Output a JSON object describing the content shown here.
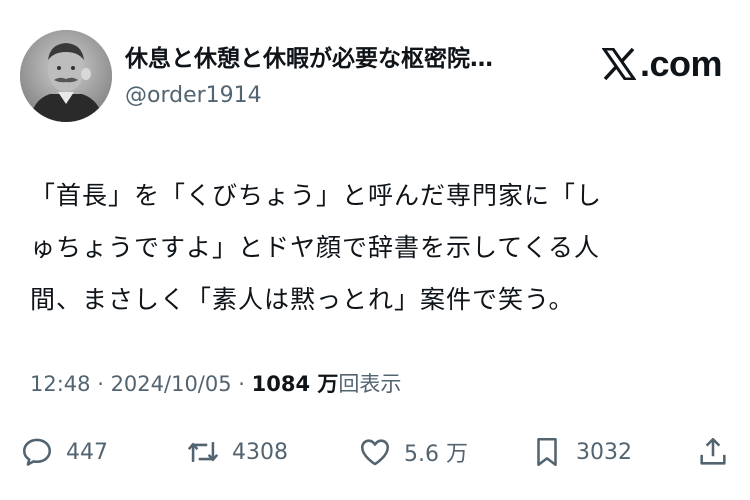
{
  "author": {
    "display_name": "休息と休憩と休暇が必要な枢密院…",
    "handle": "@order1914"
  },
  "brand": {
    "text": "com",
    "icon": "x-logo-icon"
  },
  "tweet": {
    "lines": [
      "「首長」を「くびちょう」と呼んだ専門家に「し",
      "ゅちょうですよ」とドヤ顔で辞書を示してくる人",
      "間、まさしく「素人は黙っとれ」案件で笑う。"
    ]
  },
  "meta": {
    "time": "12:48",
    "separator": " · ",
    "date": "2024/10/05",
    "views_count": "1084 万",
    "views_label": "回表示"
  },
  "actions": {
    "reply": {
      "icon": "reply-icon",
      "count": "447"
    },
    "retweet": {
      "icon": "retweet-icon",
      "count": "4308"
    },
    "like": {
      "icon": "heart-icon",
      "count": "5.6 万"
    },
    "bookmark": {
      "icon": "bookmark-icon",
      "count": "3032"
    },
    "share": {
      "icon": "share-icon"
    }
  },
  "colors": {
    "text": "#0f1419",
    "secondary": "#536471",
    "background": "#ffffff"
  }
}
